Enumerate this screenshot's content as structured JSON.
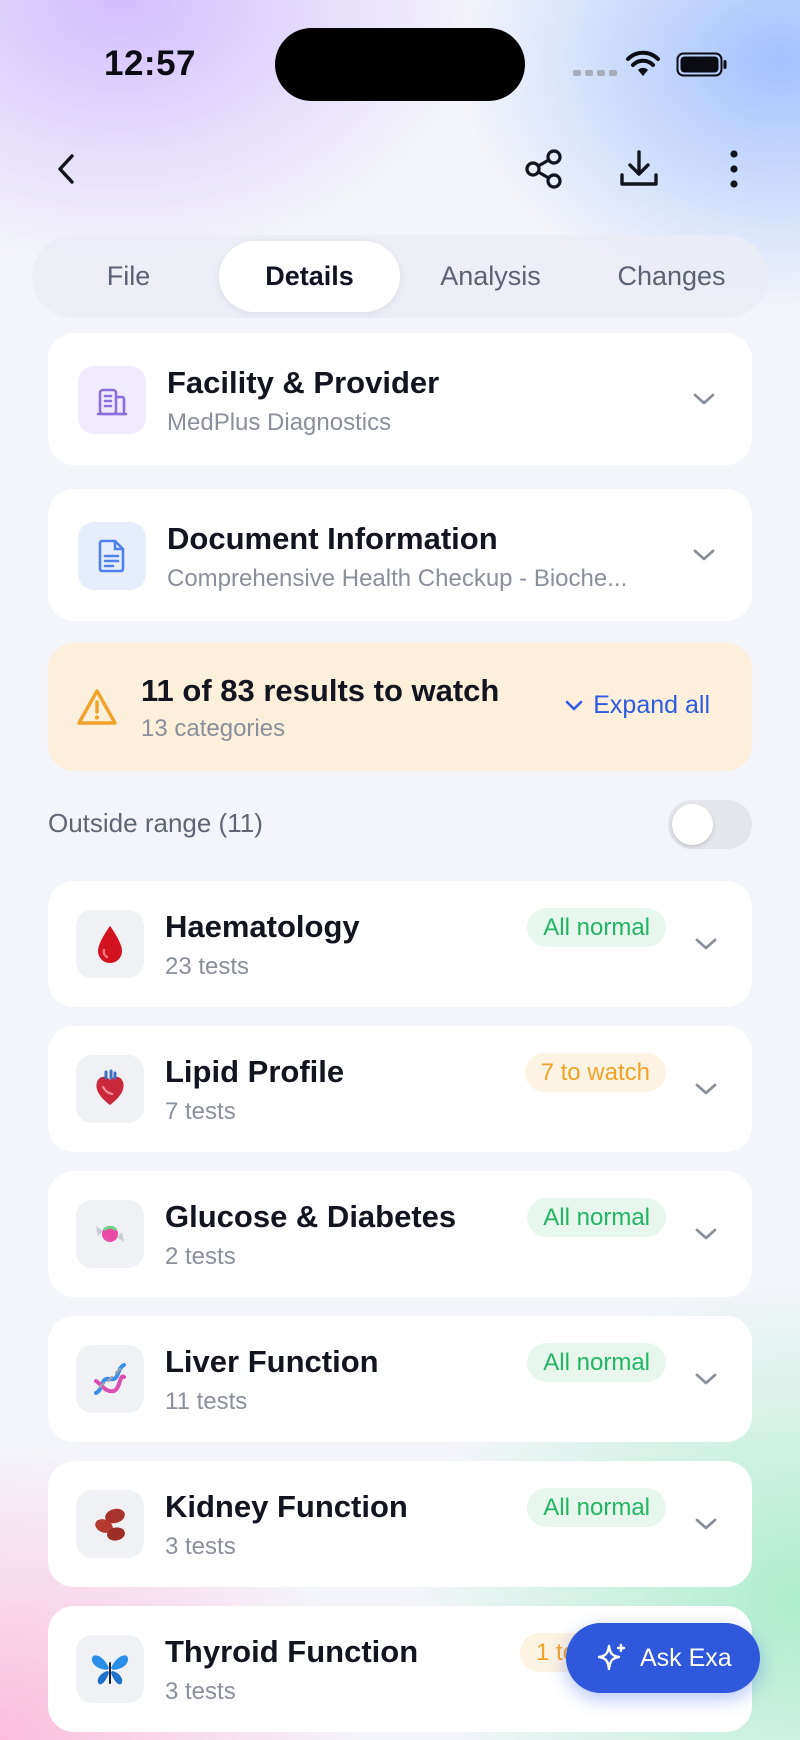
{
  "status_bar": {
    "time": "12:57"
  },
  "tabs": [
    {
      "label": "File",
      "active": false
    },
    {
      "label": "Details",
      "active": true
    },
    {
      "label": "Analysis",
      "active": false
    },
    {
      "label": "Changes",
      "active": false
    }
  ],
  "facility": {
    "title": "Facility & Provider",
    "subtitle": "MedPlus Diagnostics"
  },
  "document": {
    "title": "Document Information",
    "subtitle": "Comprehensive Health Checkup - Bioche..."
  },
  "watch_banner": {
    "title": "11 of 83 results to watch",
    "subtitle": "13 categories",
    "expand_label": "Expand all"
  },
  "outside_range": {
    "label": "Outside range (11)",
    "enabled": false
  },
  "categories": [
    {
      "name": "Haematology",
      "count": "23 tests",
      "status": "All normal",
      "kind": "normal",
      "icon": "blood-drop-icon"
    },
    {
      "name": "Lipid Profile",
      "count": "7 tests",
      "status": "7 to watch",
      "kind": "watch",
      "icon": "heart-icon"
    },
    {
      "name": "Glucose & Diabetes",
      "count": "2 tests",
      "status": "All normal",
      "kind": "normal",
      "icon": "candy-icon"
    },
    {
      "name": "Liver Function",
      "count": "11 tests",
      "status": "All normal",
      "kind": "normal",
      "icon": "dna-icon"
    },
    {
      "name": "Kidney Function",
      "count": "3 tests",
      "status": "All normal",
      "kind": "normal",
      "icon": "beans-icon"
    },
    {
      "name": "Thyroid Function",
      "count": "3 tests",
      "status": "1 to",
      "kind": "watch",
      "icon": "butterfly-icon"
    }
  ],
  "ask_button": {
    "label": "Ask Exa"
  },
  "colors": {
    "accent": "#2f58dc",
    "normal": "#22b563",
    "watch": "#f0a32b",
    "banner": "#fcefdc"
  }
}
